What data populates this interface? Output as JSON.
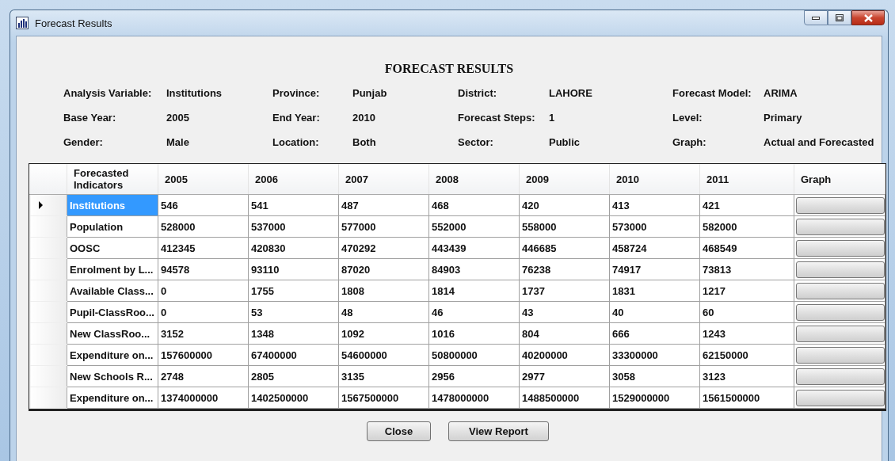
{
  "window": {
    "title": "Forecast Results"
  },
  "heading": "FORECAST RESULTS",
  "info": [
    {
      "label": "Analysis Variable:",
      "value": "Institutions"
    },
    {
      "label": "Province:",
      "value": "Punjab"
    },
    {
      "label": "District:",
      "value": "LAHORE"
    },
    {
      "label": "Forecast Model:",
      "value": "ARIMA"
    },
    {
      "label": "Base Year:",
      "value": "2005"
    },
    {
      "label": "End Year:",
      "value": "2010"
    },
    {
      "label": "Forecast Steps:",
      "value": "1"
    },
    {
      "label": "Level:",
      "value": "Primary"
    },
    {
      "label": "Gender:",
      "value": "Male"
    },
    {
      "label": "Location:",
      "value": "Both"
    },
    {
      "label": "Sector:",
      "value": "Public"
    },
    {
      "label": "Graph:",
      "value": "Actual and Forecasted"
    }
  ],
  "table": {
    "columns": [
      "Forecasted Indicators",
      "2005",
      "2006",
      "2007",
      "2008",
      "2009",
      "2010",
      "2011",
      "Graph"
    ],
    "rows": [
      {
        "selected": true,
        "indicator": "Institutions",
        "values": [
          "546",
          "541",
          "487",
          "468",
          "420",
          "413",
          "421"
        ]
      },
      {
        "selected": false,
        "indicator": "Population",
        "values": [
          "528000",
          "537000",
          "577000",
          "552000",
          "558000",
          "573000",
          "582000"
        ]
      },
      {
        "selected": false,
        "indicator": "OOSC",
        "values": [
          "412345",
          "420830",
          "470292",
          "443439",
          "446685",
          "458724",
          "468549"
        ]
      },
      {
        "selected": false,
        "indicator": "Enrolment by L...",
        "values": [
          "94578",
          "93110",
          "87020",
          "84903",
          "76238",
          "74917",
          "73813"
        ]
      },
      {
        "selected": false,
        "indicator": "Available Class...",
        "values": [
          "0",
          "1755",
          "1808",
          "1814",
          "1737",
          "1831",
          "1217"
        ]
      },
      {
        "selected": false,
        "indicator": "Pupil-ClassRoo...",
        "values": [
          "0",
          "53",
          "48",
          "46",
          "43",
          "40",
          "60"
        ]
      },
      {
        "selected": false,
        "indicator": "New ClassRoo...",
        "values": [
          "3152",
          "1348",
          "1092",
          "1016",
          "804",
          "666",
          "1243"
        ]
      },
      {
        "selected": false,
        "indicator": "Expenditure on...",
        "values": [
          "157600000",
          "67400000",
          "54600000",
          "50800000",
          "40200000",
          "33300000",
          "62150000"
        ]
      },
      {
        "selected": false,
        "indicator": "New Schools R...",
        "values": [
          "2748",
          "2805",
          "3135",
          "2956",
          "2977",
          "3058",
          "3123"
        ]
      },
      {
        "selected": false,
        "indicator": "Expenditure on...",
        "values": [
          "1374000000",
          "1402500000",
          "1567500000",
          "1478000000",
          "1488500000",
          "1529000000",
          "1561500000"
        ]
      }
    ]
  },
  "buttons": [
    "Close",
    "View Report"
  ]
}
